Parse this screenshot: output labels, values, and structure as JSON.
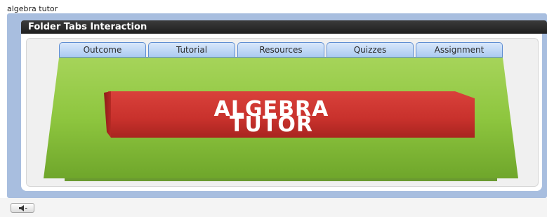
{
  "app": {
    "title": "algebra tutor"
  },
  "window": {
    "title": "Folder Tabs Interaction"
  },
  "tabs": [
    {
      "label": "Outcome"
    },
    {
      "label": "Tutorial"
    },
    {
      "label": "Resources"
    },
    {
      "label": "Quizzes"
    },
    {
      "label": "Assignment"
    }
  ],
  "banner": {
    "line1": "ALGEBRA",
    "line2": "TUTOR"
  },
  "controls": {
    "sound_icon": "speaker-icon"
  },
  "colors": {
    "frame": "#a8bedf",
    "titlebar": "#2b2b2b",
    "tab_fill": "#bcd6f5",
    "tab_border": "#5f8ed2",
    "green": "#8ec63f",
    "red": "#c8312c"
  }
}
